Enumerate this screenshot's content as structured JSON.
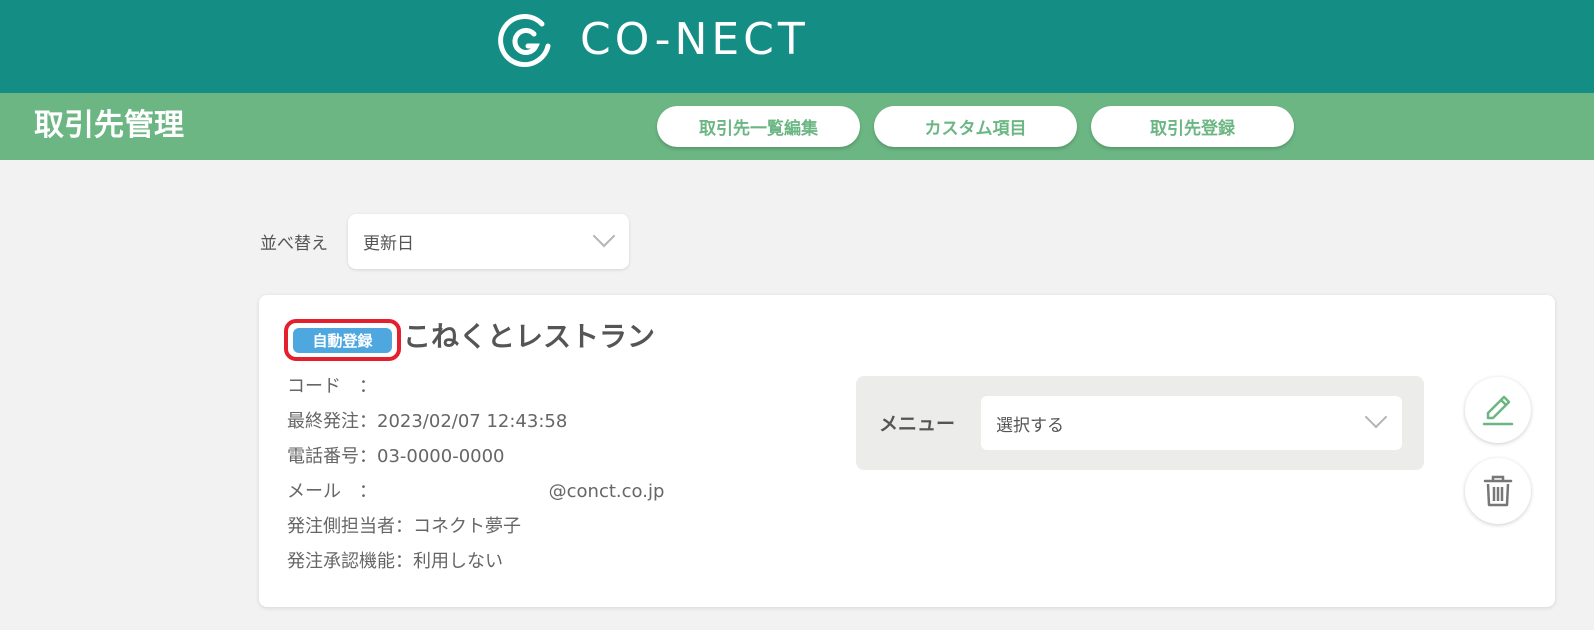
{
  "brand": {
    "logo_text": "CO-NECT"
  },
  "header": {
    "title": "取引先管理",
    "buttons": [
      "取引先一覧編集",
      "カスタム項目",
      "取引先登録"
    ]
  },
  "sort": {
    "label": "並べ替え",
    "selected": "更新日"
  },
  "client": {
    "badge": "自動登録",
    "name": "こねくとレストラン",
    "fields": [
      {
        "text": "コード　："
      },
      {
        "text": "最終発注：2023/02/07 12:43:58"
      },
      {
        "text": "電話番号：03-0000-0000"
      },
      {
        "text": "メール　：                              @conct.co.jp"
      },
      {
        "text": "発注側担当者：コネクト夢子"
      },
      {
        "text": "発注承認機能：利用しない"
      }
    ],
    "menu": {
      "label": "メニュー",
      "selected": "選択する"
    },
    "actions": {
      "edit_icon": "pencil-icon",
      "delete_icon": "trash-icon"
    }
  },
  "colors": {
    "header_bg": "#148e84",
    "subheader_bg": "#6bb683",
    "badge_bg": "#4fa7e0",
    "badge_highlight": "#e5202e"
  }
}
